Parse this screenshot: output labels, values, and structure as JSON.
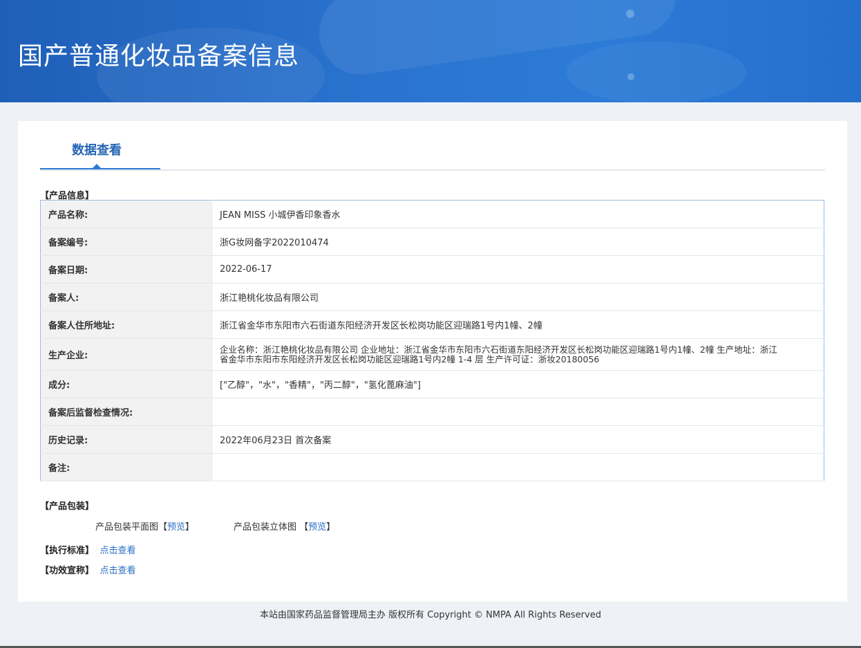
{
  "header": {
    "title": "国产普通化妆品备案信息"
  },
  "tab": {
    "label": "数据查看"
  },
  "product_info": {
    "section_title": "【产品信息】",
    "rows": [
      {
        "label": "产品名称:",
        "value": "JEAN MISS 小城伊香印象香水"
      },
      {
        "label": "备案编号:",
        "value": "浙G妆网备字2022010474"
      },
      {
        "label": "备案日期:",
        "value": "2022-06-17"
      },
      {
        "label": "备案人:",
        "value": "浙江艳桃化妆品有限公司"
      },
      {
        "label": "备案人住所地址:",
        "value": "浙江省金华市东阳市六石街道东阳经济开发区长松岗功能区迎瑞路1号内1幢、2幢"
      },
      {
        "label": "生产企业:",
        "value": "企业名称：浙江艳桃化妆品有限公司 企业地址：浙江省金华市东阳市六石街道东阳经济开发区长松岗功能区迎瑞路1号内1幢、2幢 生产地址：浙江省金华市东阳市东阳经济开发区长松岗功能区迎瑞路1号内2幢 1-4 层 生产许可证：浙妆20180056"
      },
      {
        "label": "成分:",
        "value": "[\"乙醇\"，\"水\"，\"香精\"，\"丙二醇\"，\"氢化蓖麻油\"]"
      },
      {
        "label": "备案后监督检查情况:",
        "value": ""
      },
      {
        "label": "历史记录:",
        "value": "2022年06月23日 首次备案"
      },
      {
        "label": "备注:",
        "value": ""
      }
    ]
  },
  "packaging": {
    "section_title": "【产品包装】",
    "flat_label": "产品包装平面图【",
    "flat_link": "预览",
    "flat_close": "】",
    "solid_label": "产品包装立体图 【",
    "solid_link": "预览",
    "solid_close": "】"
  },
  "standard": {
    "section_title": "【执行标准】",
    "link": "点击查看"
  },
  "efficacy": {
    "section_title": "【功效宣称】",
    "link": "点击查看"
  },
  "footer": {
    "text": "本站由国家药品监督管理局主办 版权所有 Copyright © NMPA All Rights Reserved"
  }
}
